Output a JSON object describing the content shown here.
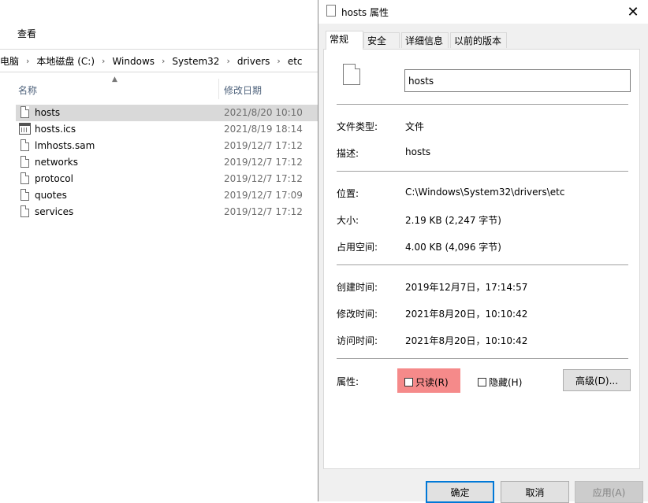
{
  "explorer": {
    "ribbon_tab": "查看",
    "breadcrumb": [
      "此电脑",
      "本地磁盘 (C:)",
      "Windows",
      "System32",
      "drivers",
      "etc"
    ],
    "columns": {
      "name": "名称",
      "date": "修改日期"
    },
    "files": [
      {
        "name": "hosts",
        "date": "2021/8/20 10:10",
        "icon": "file-icon",
        "selected": true
      },
      {
        "name": "hosts.ics",
        "date": "2021/8/19 18:14",
        "icon": "calendar-icon",
        "selected": false
      },
      {
        "name": "lmhosts.sam",
        "date": "2019/12/7 17:12",
        "icon": "file-icon",
        "selected": false
      },
      {
        "name": "networks",
        "date": "2019/12/7 17:12",
        "icon": "file-icon",
        "selected": false
      },
      {
        "name": "protocol",
        "date": "2019/12/7 17:12",
        "icon": "file-icon",
        "selected": false
      },
      {
        "name": "quotes",
        "date": "2019/12/7 17:09",
        "icon": "file-icon",
        "selected": false
      },
      {
        "name": "services",
        "date": "2019/12/7 17:12",
        "icon": "file-icon",
        "selected": false
      }
    ]
  },
  "dialog": {
    "title": "hosts 属性",
    "tabs": [
      "常规",
      "安全",
      "详细信息",
      "以前的版本"
    ],
    "active_tab": "常规",
    "file_name": "hosts",
    "file_type_label": "文件类型:",
    "file_type_value": "文件",
    "desc_label": "描述:",
    "desc_value": "hosts",
    "location_label": "位置:",
    "location_value": "C:\\Windows\\System32\\drivers\\etc",
    "size_label": "大小:",
    "size_value": "2.19 KB (2,247 字节)",
    "disk_label": "占用空间:",
    "disk_value": "4.00 KB (4,096 字节)",
    "created_label": "创建时间:",
    "created_value": "2019年12月7日，17:14:57",
    "modified_label": "修改时间:",
    "modified_value": "2021年8月20日，10:10:42",
    "accessed_label": "访问时间:",
    "accessed_value": "2021年8月20日，10:10:42",
    "attr_label": "属性:",
    "readonly_label": "只读(R)",
    "readonly_checked": false,
    "hidden_label": "隐藏(H)",
    "hidden_checked": false,
    "advanced_label": "高级(D)...",
    "ok_label": "确定",
    "cancel_label": "取消",
    "apply_label": "应用(A)",
    "close_glyph": "✕",
    "highlight_color": "#f58a8a"
  }
}
